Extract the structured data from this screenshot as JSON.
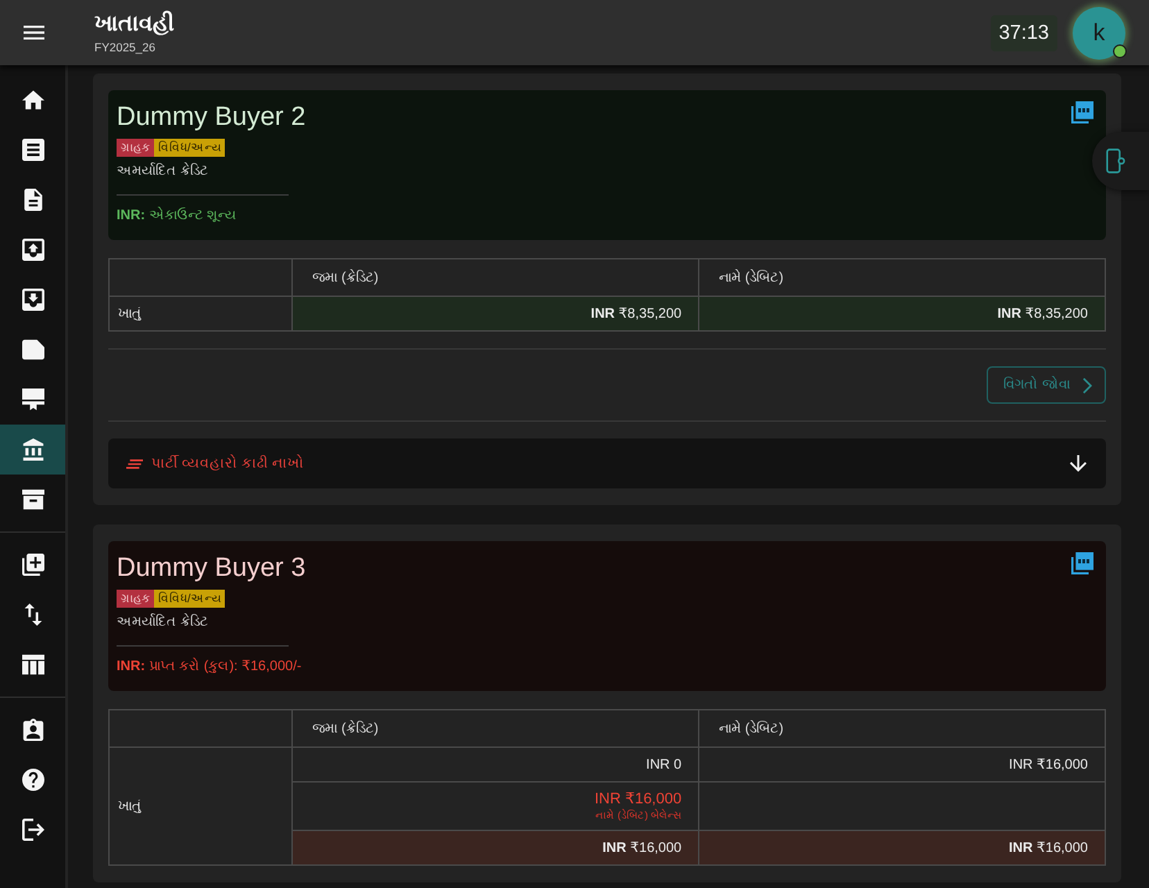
{
  "app_bar": {
    "title": "ખાતાવહી",
    "subtitle": "FY2025_26",
    "timer": "37:13",
    "avatar": {
      "initial": "k",
      "online": true
    }
  },
  "sidebar": {
    "sections": [
      {
        "items": [
          {
            "selected": false
          },
          {
            "selected": false
          },
          {
            "selected": false
          },
          {
            "selected": false
          },
          {
            "selected": false
          },
          {
            "selected": false
          },
          {
            "selected": false
          },
          {
            "selected": true
          },
          {
            "selected": false
          }
        ]
      },
      {
        "items": [
          {
            "selected": false
          },
          {
            "selected": false
          },
          {
            "selected": false
          }
        ]
      },
      {
        "items": [
          {
            "selected": false
          },
          {
            "selected": false
          },
          {
            "selected": false
          }
        ]
      }
    ]
  },
  "parties": [
    {
      "kind": "settled",
      "name": "Dummy Buyer 2",
      "tags": [
        {
          "label": "ગ્રાહક",
          "color": "#b3303f"
        },
        {
          "label": "વિવિધ/અન્ય",
          "color": "#c9a106"
        }
      ],
      "credit_limit": "અમર્યાદિત ક્રેડિટ",
      "balance": "**INR:** એકાઉન્ટ શૂન્ય",
      "table": {
        "columns": [
          "જમા (ક્રેડિટ)",
          "નામે (ડેબિટ)"
        ],
        "row_label": "ખાતું",
        "rows": [
          {
            "kind": "total",
            "cells": [
              {
                "text": "**INR** ₹8,35,200"
              },
              {
                "text": "**INR** ₹8,35,200"
              }
            ]
          }
        ]
      },
      "details_button": "વિગતો જોવા",
      "delete_bar": "પાર્ટી વ્યવહારો કાઢી નાખો"
    },
    {
      "kind": "due",
      "name": "Dummy Buyer 3",
      "tags": [
        {
          "label": "ગ્રાહક",
          "color": "#b3303f"
        },
        {
          "label": "વિવિધ/અન્ય",
          "color": "#c9a106"
        }
      ],
      "credit_limit": "અમર્યાદિત ક્રેડિટ",
      "balance": "**INR:** પ્રાપ્ત કરો (કુલ): ₹16,000/-",
      "table": {
        "columns": [
          "જમા (ક્રેડિટ)",
          "નામે (ડેબિટ)"
        ],
        "row_label": "ખાતું",
        "rows": [
          {
            "kind": "entry",
            "cells": [
              {
                "text": "INR 0"
              },
              {
                "text": "INR ₹16,000"
              }
            ]
          },
          {
            "kind": "balance",
            "cells": [
              {
                "text": "INR ₹16,000",
                "note": "નામે (ડેબિટ) બેલેન્સ"
              },
              {}
            ]
          },
          {
            "kind": "total",
            "cells": [
              {
                "text": "**INR** ₹16,000"
              },
              {
                "text": "**INR** ₹16,000"
              }
            ]
          }
        ]
      }
    }
  ]
}
